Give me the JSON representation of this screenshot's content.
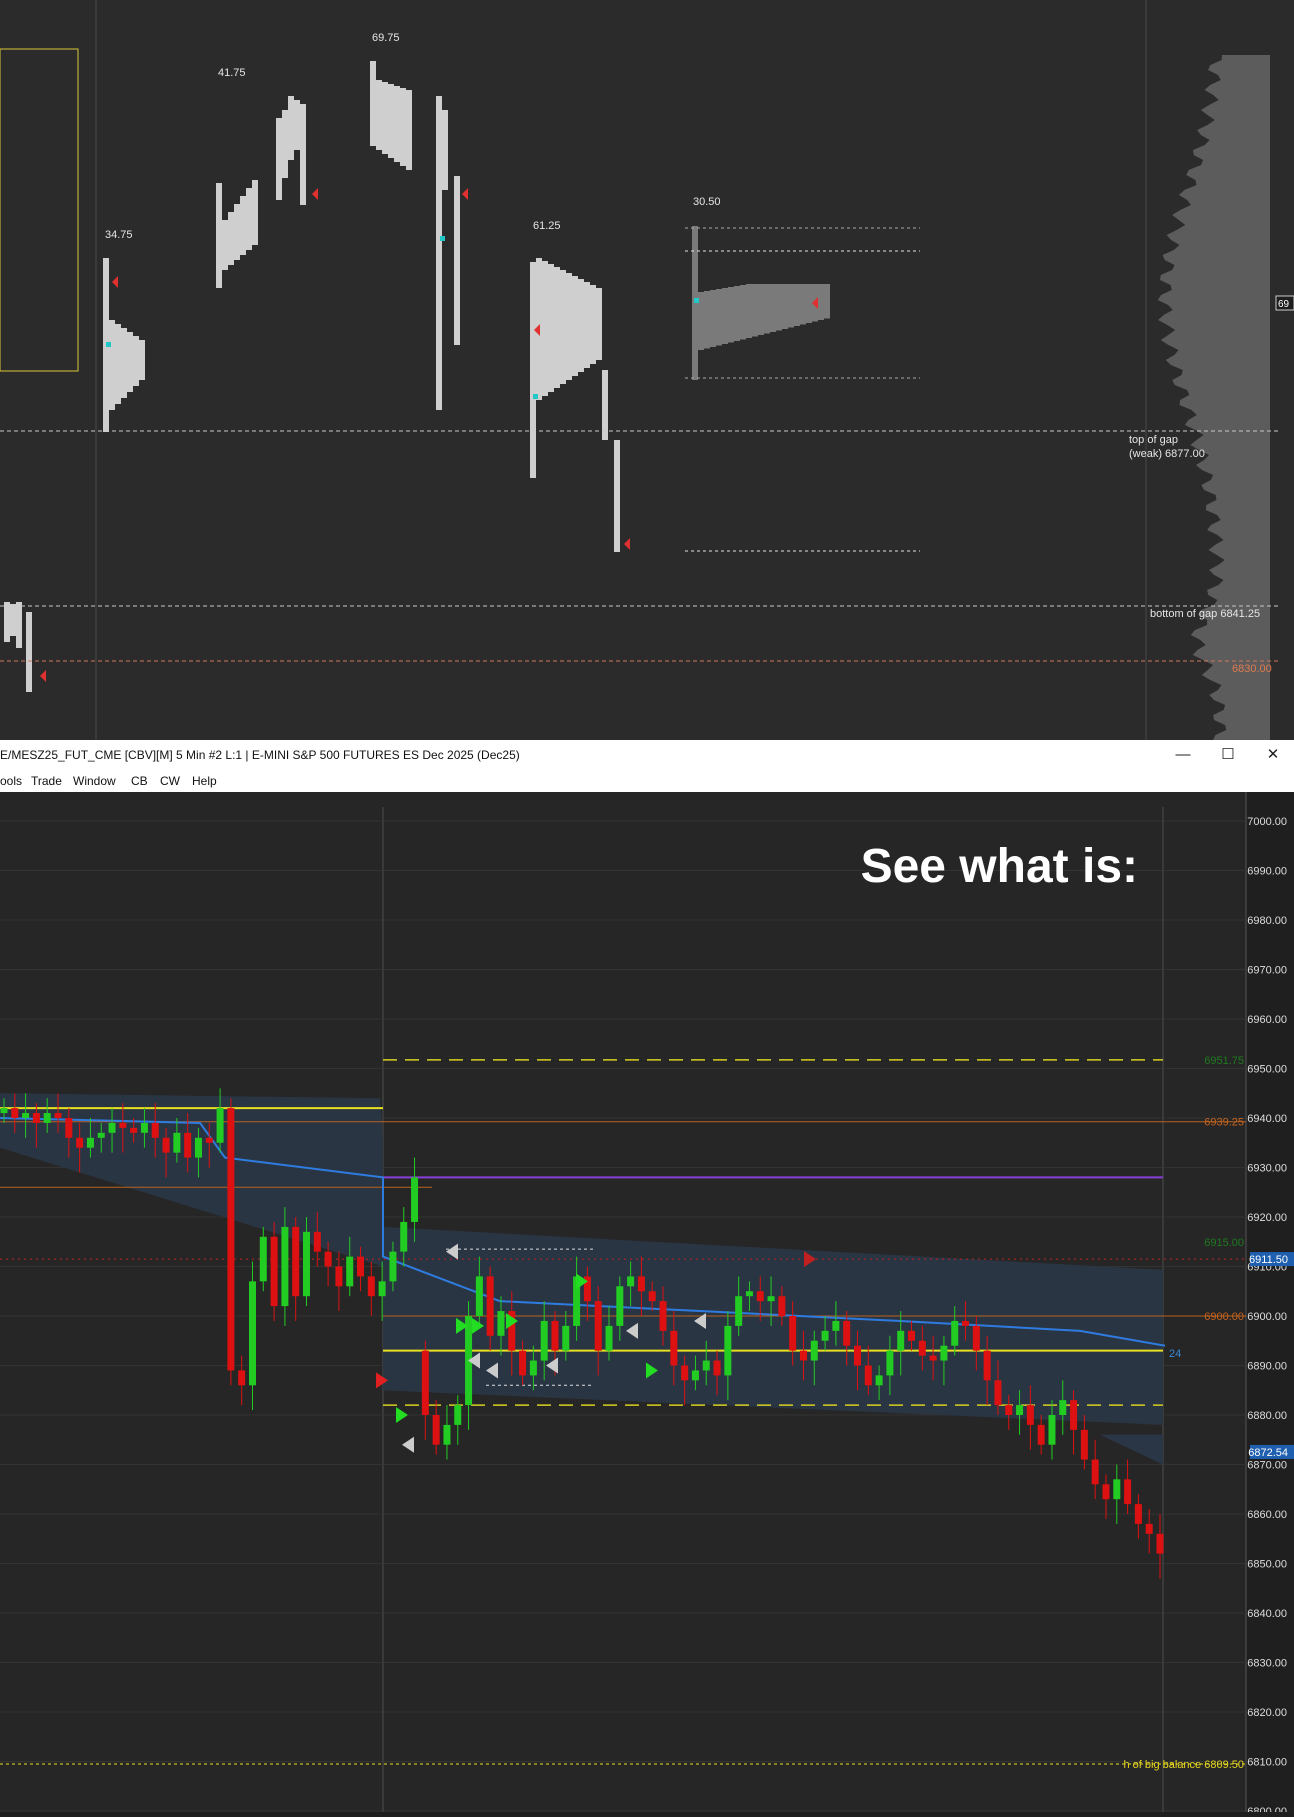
{
  "window": {
    "title": "E/MESZ25_FUT_CME [CBV][M]  5 Min  #2 L:1 | E-MINI S&P 500 FUTURES ES Dec 2025 (Dec25)",
    "minimize_label": "—",
    "maximize_label": "☐",
    "close_label": "✕"
  },
  "menu": {
    "items": [
      "ools",
      "Trade",
      "Window",
      "CB",
      "CW",
      "Help"
    ]
  },
  "top_chart": {
    "profile_labels": [
      "34.75",
      "41.75",
      "69.75",
      "61.25",
      "30.50"
    ],
    "right_axis_partial": "69",
    "annotations": {
      "gap_top_line1": "top of gap",
      "gap_top_line2": "(weak)  6877.00",
      "gap_bottom": "bottom of gap  6841.25",
      "level_6830": "6830.00"
    }
  },
  "bottom_chart": {
    "headline": "See what is:",
    "chart_data": {
      "type": "candlestick",
      "timeframe": "5 Min",
      "instrument": "E-MINI S&P 500 FUTURES ES Dec 2025 (Dec25)",
      "ylim": [
        6800,
        7000
      ],
      "y_ticks": [
        "7000.00",
        "6990.00",
        "6980.00",
        "6970.00",
        "6960.00",
        "6950.00",
        "6940.00",
        "6930.00",
        "6920.00",
        "6910.00",
        "6900.00",
        "6890.00",
        "6880.00",
        "6870.00",
        "6860.00",
        "6850.00",
        "6840.00",
        "6830.00",
        "6820.00",
        "6810.00",
        "6800.00"
      ],
      "levels": [
        {
          "label": "6951.75",
          "value": 6951.75,
          "color": "#1e7a1e"
        },
        {
          "label": "6939.25",
          "value": 6939.25,
          "color": "#c8641e"
        },
        {
          "label": "6915.00",
          "value": 6915.0,
          "color": "#1e7a1e"
        },
        {
          "label": "6911.50",
          "value": 6911.5,
          "color": "#3a8ad8"
        },
        {
          "label": "6900.00",
          "value": 6900.0,
          "color": "#c8641e"
        },
        {
          "label": "24",
          "value": 6892.5,
          "color": "#3a8ad8"
        },
        {
          "label": "6872.54",
          "value": 6872.54,
          "color": "#3a8ad8"
        },
        {
          "label": "h of big balance  6809.50",
          "value": 6809.5,
          "color": "#e8d820"
        }
      ],
      "colors": {
        "up": "#22cc22",
        "down": "#dd1111",
        "vwap": "#2f7ce0",
        "band": "#2a3646",
        "background": "#262626"
      }
    }
  }
}
